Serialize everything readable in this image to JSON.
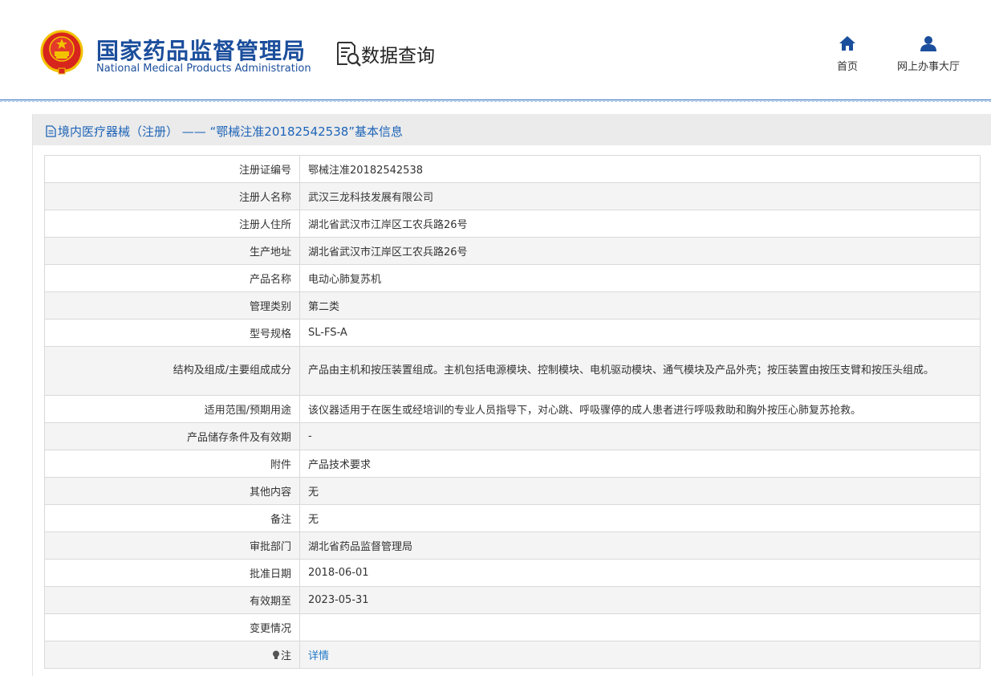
{
  "header": {
    "brand_cn": "国家药品监督管理局",
    "brand_en": "National Medical Products Administration",
    "query_label": "数据查询",
    "nav": [
      {
        "label": "首页",
        "icon": "home-icon"
      },
      {
        "label": "网上办事大厅",
        "icon": "user-icon"
      }
    ]
  },
  "panel": {
    "title": "境内医疗器械（注册） —— “鄂械注准20182542538”基本信息"
  },
  "rows": [
    {
      "label": "注册证编号",
      "value": "鄂械注准20182542538"
    },
    {
      "label": "注册人名称",
      "value": "武汉三龙科技发展有限公司"
    },
    {
      "label": "注册人住所",
      "value": "湖北省武汉市江岸区工农兵路26号"
    },
    {
      "label": "生产地址",
      "value": "湖北省武汉市江岸区工农兵路26号"
    },
    {
      "label": "产品名称",
      "value": "电动心肺复苏机"
    },
    {
      "label": "管理类别",
      "value": "第二类"
    },
    {
      "label": "型号规格",
      "value": "SL-FS-A"
    },
    {
      "label": "结构及组成/主要组成成分",
      "value": "产品由主机和按压装置组成。主机包括电源模块、控制模块、电机驱动模块、通气模块及产品外壳；按压装置由按压支臂和按压头组成。"
    },
    {
      "label": "适用范围/预期用途",
      "value": "该仪器适用于在医生或经培训的专业人员指导下，对心跳、呼吸骤停的成人患者进行呼吸救助和胸外按压心肺复苏抢救。"
    },
    {
      "label": "产品储存条件及有效期",
      "value": "-"
    },
    {
      "label": "附件",
      "value": "产品技术要求"
    },
    {
      "label": "其他内容",
      "value": "无"
    },
    {
      "label": "备注",
      "value": "无"
    },
    {
      "label": "审批部门",
      "value": "湖北省药品监督管理局"
    },
    {
      "label": "批准日期",
      "value": "2018-06-01"
    },
    {
      "label": "有效期至",
      "value": "2023-05-31"
    },
    {
      "label": "变更情况",
      "value": ""
    }
  ],
  "note_row": {
    "label": "注",
    "link": "详情",
    "icon": "lightbulb-icon"
  },
  "colors": {
    "brand_blue": "#1b4e9c",
    "link_blue": "#1e78c8",
    "emblem_red": "#d7241d",
    "emblem_gold": "#f2c200"
  }
}
